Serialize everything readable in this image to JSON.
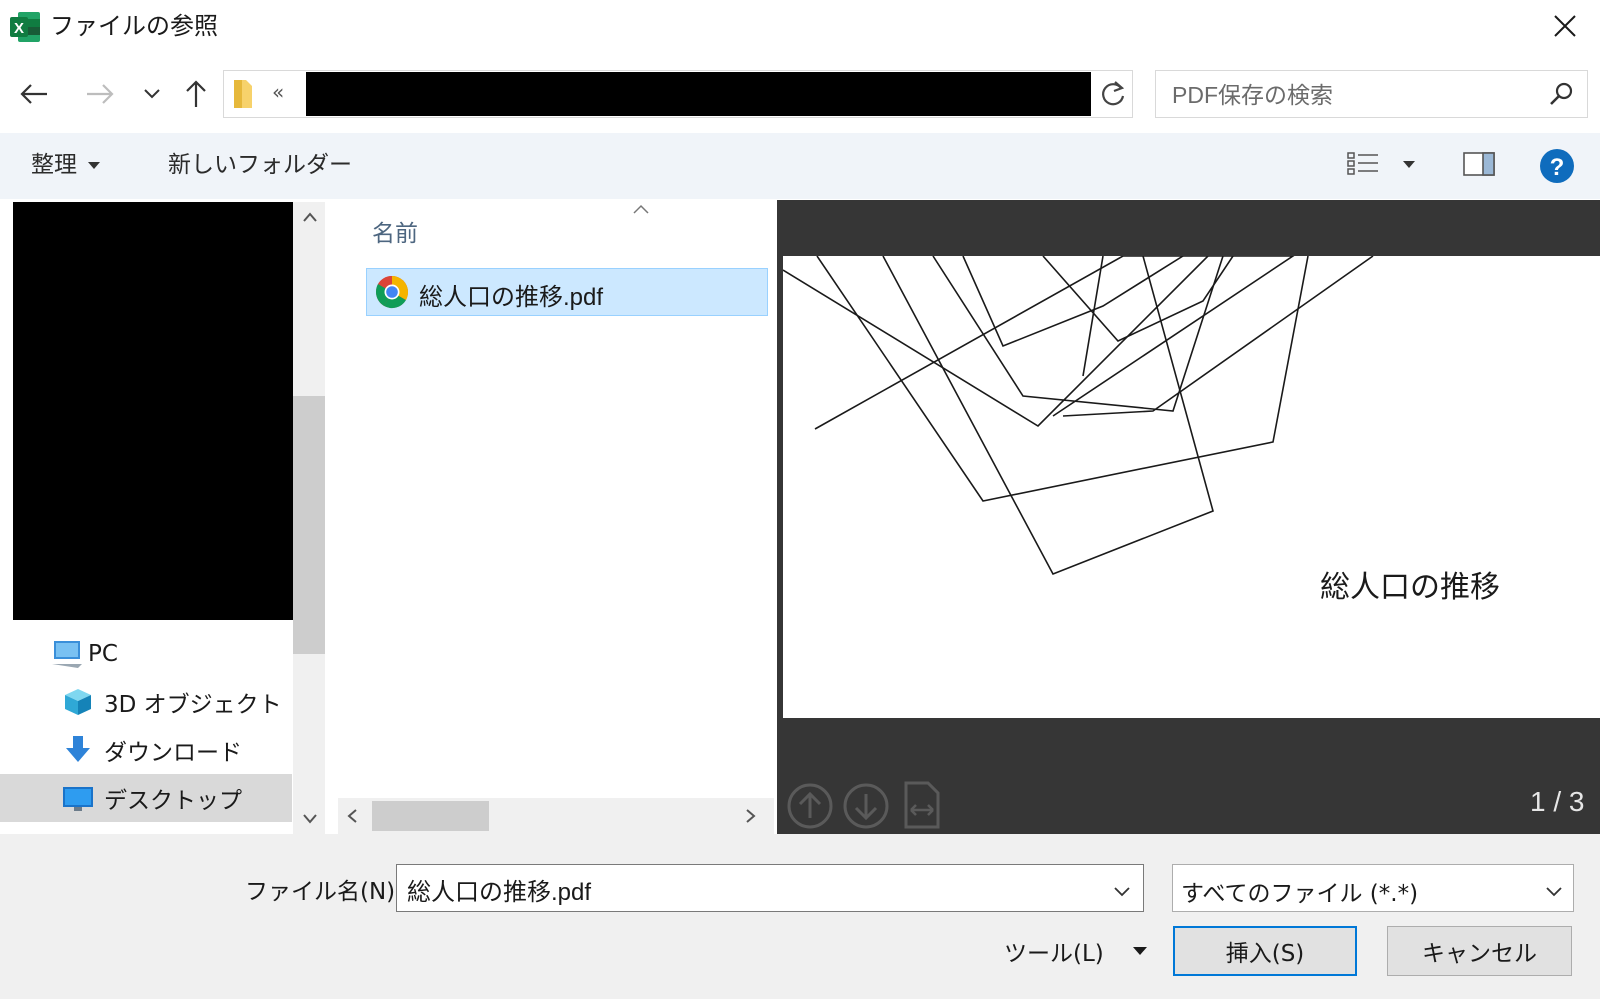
{
  "window": {
    "title": "ファイルの参照",
    "app_icon": "excel-icon",
    "brand_color": "#1e7145"
  },
  "address_bar": {
    "overflow_chevron": "«",
    "path_redacted": true
  },
  "search": {
    "placeholder": "PDF保存の検索"
  },
  "toolbar": {
    "organize_label": "整理",
    "new_folder_label": "新しいフォルダー"
  },
  "nav_pane": {
    "items": [
      {
        "label": "PC",
        "icon": "pc-icon"
      },
      {
        "label": "3D オブジェクト",
        "icon": "3d-objects-icon"
      },
      {
        "label": "ダウンロード",
        "icon": "download-icon"
      },
      {
        "label": "デスクトップ",
        "icon": "desktop-icon",
        "selected": true
      }
    ]
  },
  "file_list": {
    "column_name": "名前",
    "files": [
      {
        "name": "総人口の推移.pdf",
        "icon": "chrome-icon",
        "selected": true
      }
    ]
  },
  "preview": {
    "page_title": "総人口の推移",
    "page_counter": "1 / 3"
  },
  "bottom": {
    "filename_label": "ファイル名(N):",
    "filename_value": "総人口の推移.pdf",
    "filetype_value": "すべてのファイル (*.*)",
    "tools_label": "ツール(L)",
    "insert_label": "挿入(S)",
    "cancel_label": "キャンセル"
  },
  "colors": {
    "accent": "#0078d7",
    "selection": "#cce8ff",
    "preview_bg": "#363636",
    "help_blue": "#0f6cbd"
  }
}
